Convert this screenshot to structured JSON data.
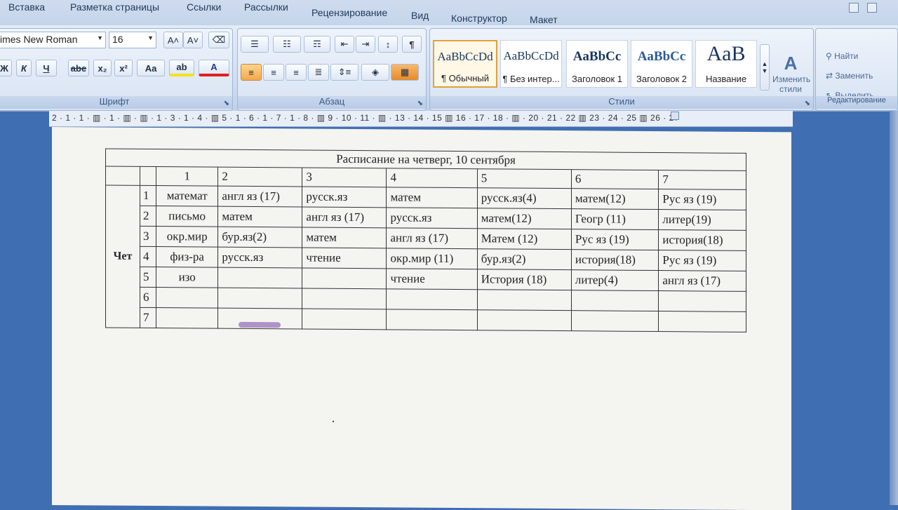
{
  "ribbon_tabs": [
    "Вставка",
    "Разметка страницы",
    "Ссылки",
    "Рассылки",
    "Рецензирование",
    "Вид",
    "Конструктор",
    "Макет"
  ],
  "font_group": {
    "font_name": "imes New Roman",
    "font_size": "16",
    "grow_label": "A˄",
    "shrink_label": "A˅",
    "bold": "Ж",
    "italic": "К",
    "underline": "Ч",
    "strike": "abe",
    "subscript": "x₂",
    "superscript": "x²",
    "case": "Aa",
    "highlight": "ab",
    "font_color": "A",
    "label": "Шрифт"
  },
  "paragraph_group": {
    "label": "Абзац",
    "pilcrow": "¶"
  },
  "styles_group": {
    "label": "Стили",
    "styles": [
      {
        "sample": "AaBbCcDd",
        "name": "¶ Обычный"
      },
      {
        "sample": "AaBbCcDd",
        "name": "¶ Без интер..."
      },
      {
        "sample": "AaBbCс",
        "name": "Заголовок 1"
      },
      {
        "sample": "AaBbCс",
        "name": "Заголовок 2"
      },
      {
        "sample": "AaB",
        "name": "Название"
      }
    ],
    "change_styles": "Изменить стили"
  },
  "editing_group": {
    "find": "Найти",
    "replace": "Заменить",
    "select": "Выделить",
    "label": "Редактирование"
  },
  "ruler_text": "2 · 1 · 1 · ▥ · 1 · ▥ · ▥ · 1 · 3 · 1 · 4 · ▥ 5 · 1 · 6 · 1 · 7 · 1 · 8 · ▥ 9 · 10 · 11 · ▥ · 13 · 14 · 15 ▥ 16 · 17 · 18 · ▥ · 20 · 21 · 22 ▥ 23 · 24 · 25 ▥ 26 · 27",
  "table": {
    "title": "Расписание на четверг, 10 сентября",
    "day": "Чет",
    "columns": [
      "1",
      "2",
      "3",
      "4",
      "5",
      "6",
      "7"
    ],
    "rows": [
      {
        "n": "1",
        "cells": [
          "математ",
          "англ яз (17)",
          "русск.яз",
          "матем",
          "русск.яз(4)",
          "матем(12)",
          "Рус яз (19)"
        ]
      },
      {
        "n": "2",
        "cells": [
          "письмо",
          "матем",
          "англ яз (17)",
          "русск.яз",
          "матем(12)",
          "Геогр (11)",
          "литер(19)"
        ]
      },
      {
        "n": "3",
        "cells": [
          "окр.мир",
          "бур.яз(2)",
          "матем",
          "англ яз (17)",
          "Матем (12)",
          "Рус яз (19)",
          "история(18)"
        ]
      },
      {
        "n": "4",
        "cells": [
          "физ-ра",
          "русск.яз",
          "чтение",
          "окр.мир (11)",
          "бур.яз(2)",
          "история(18)",
          "Рус яз (19)"
        ]
      },
      {
        "n": "5",
        "cells": [
          "изо",
          "",
          "",
          "чтение",
          "История (18)",
          "литер(4)",
          "англ яз (17)"
        ]
      },
      {
        "n": "6",
        "cells": [
          "",
          "",
          "",
          "",
          "",
          "",
          ""
        ]
      },
      {
        "n": "7",
        "cells": [
          "",
          "",
          "",
          "",
          "",
          "",
          ""
        ]
      }
    ]
  }
}
